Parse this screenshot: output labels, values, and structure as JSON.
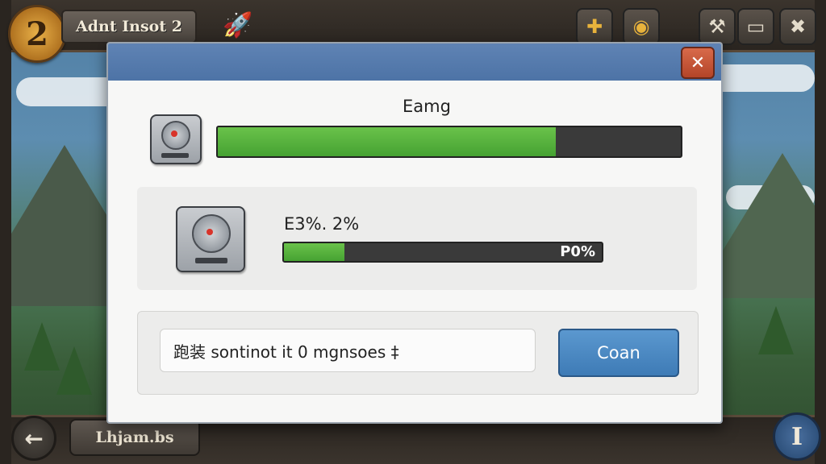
{
  "hud": {
    "level": "2",
    "title": "Adnt Insot 2",
    "bottom_label": "Lhjam.bs"
  },
  "icons": {
    "top_left_rocket": "rocket-icon",
    "top_right": [
      "plus-icon",
      "eye-icon",
      "wrench-icon",
      "controller-icon",
      "close-icon"
    ],
    "bottom_left": "back-arrow-icon",
    "bottom_right": "info-icon"
  },
  "dialog": {
    "close_label": "✕",
    "section1": {
      "caption": "Eamg",
      "progress": 0.73
    },
    "section2": {
      "caption": "E3%. 2%",
      "progress": 0.19,
      "bar_label": "P0%"
    },
    "section3": {
      "message": "跑装 sontinot it 0 mgnsoes ‡",
      "button_label": "Coan"
    }
  },
  "colors": {
    "header": "#5f83b4",
    "progress_green": "#56b23e",
    "button_blue": "#4a88c2",
    "close_red": "#c4553a"
  }
}
